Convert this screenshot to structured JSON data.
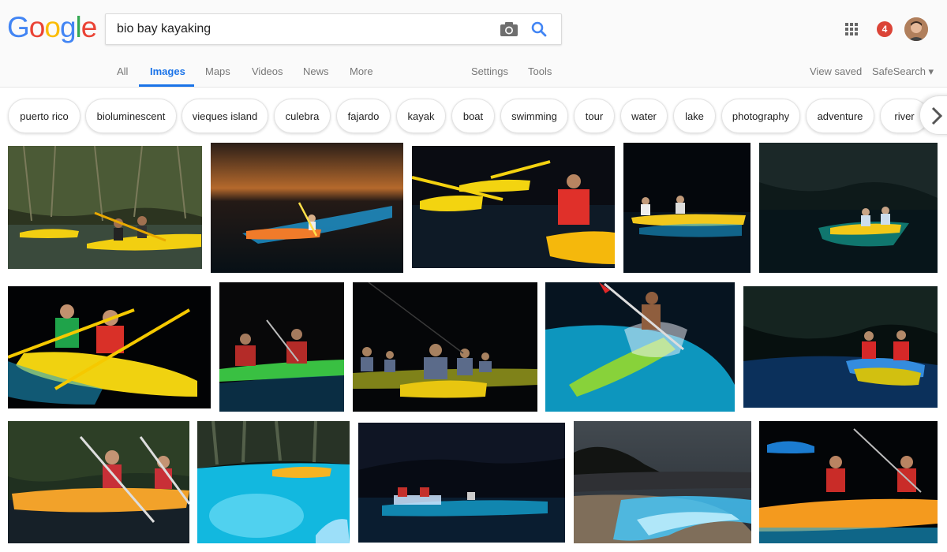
{
  "logo": {
    "letters": [
      "G",
      "o",
      "o",
      "g",
      "l",
      "e"
    ],
    "colors": [
      "#4285f4",
      "#ea4335",
      "#fbbc05",
      "#4285f4",
      "#34a853",
      "#ea4335"
    ]
  },
  "search": {
    "value": "bio bay kayaking",
    "camera_icon": "camera-icon",
    "search_icon": "search-icon"
  },
  "header": {
    "apps_icon": "apps-grid-icon",
    "notification_count": "4"
  },
  "tabs": {
    "all": "All",
    "images": "Images",
    "maps": "Maps",
    "videos": "Videos",
    "news": "News",
    "more": "More",
    "settings": "Settings",
    "tools": "Tools",
    "view_saved": "View saved",
    "safesearch": "SafeSearch ▾"
  },
  "chips": [
    "puerto rico",
    "bioluminescent",
    "vieques island",
    "culebra",
    "fajardo",
    "kayak",
    "boat",
    "swimming",
    "tour",
    "water",
    "lake",
    "photography",
    "adventure",
    "river"
  ],
  "colors": {
    "accent": "#1a73e8",
    "badge": "#db4437",
    "glow": "#2fd3ff",
    "kayak_yellow": "#f4c400",
    "kayak_orange": "#f08a1e",
    "kayak_green": "#7ec832"
  }
}
